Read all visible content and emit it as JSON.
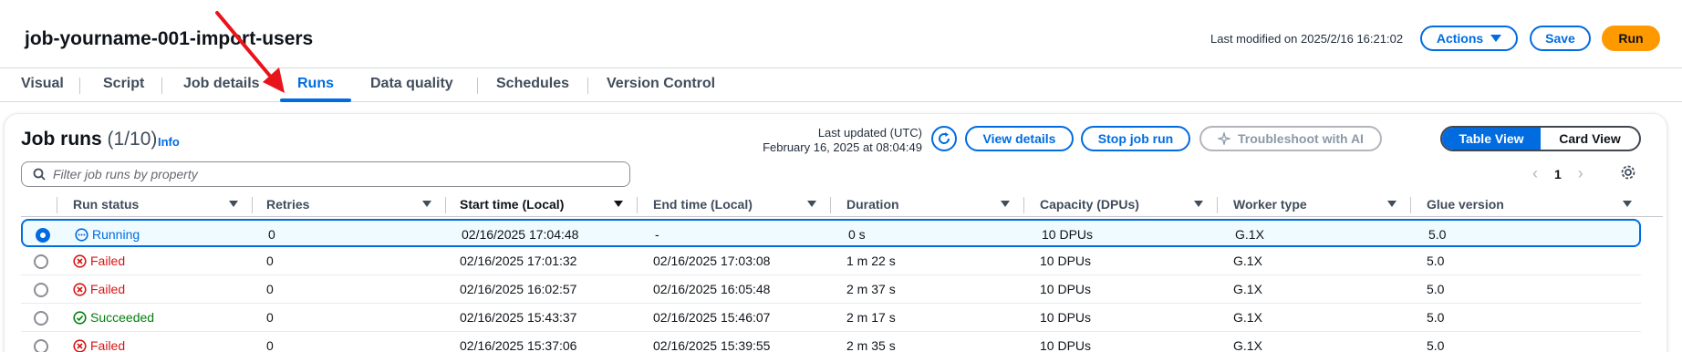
{
  "header": {
    "job_title": "job-yourname-001-import-users",
    "last_modified": "Last modified on 2025/2/16 16:21:02",
    "actions_label": "Actions",
    "save_label": "Save",
    "run_label": "Run"
  },
  "tabs": [
    {
      "label": "Visual"
    },
    {
      "label": "Script"
    },
    {
      "label": "Job details"
    },
    {
      "label": "Runs",
      "active": true
    },
    {
      "label": "Data quality"
    },
    {
      "label": "Schedules"
    },
    {
      "label": "Version Control"
    }
  ],
  "panel": {
    "title": "Job runs",
    "count": "(1/10)",
    "info": "Info",
    "last_updated_label": "Last updated (UTC)",
    "last_updated_value": "February 16, 2025 at 08:04:49",
    "view_details": "View details",
    "stop_job_run": "Stop job run",
    "troubleshoot": "Troubleshoot with AI",
    "table_view": "Table View",
    "card_view": "Card View",
    "filter_placeholder": "Filter job runs by property",
    "page": "1"
  },
  "table": {
    "columns": [
      "Run status",
      "Retries",
      "Start time (Local)",
      "End time (Local)",
      "Duration",
      "Capacity (DPUs)",
      "Worker type",
      "Glue version"
    ],
    "rows": [
      {
        "status": "Running",
        "state": "running",
        "retries": "0",
        "start": "02/16/2025 17:04:48",
        "end": "-",
        "duration": "0 s",
        "capacity": "10 DPUs",
        "worker": "G.1X",
        "glue": "5.0",
        "selected": true
      },
      {
        "status": "Failed",
        "state": "failed",
        "retries": "0",
        "start": "02/16/2025 17:01:32",
        "end": "02/16/2025 17:03:08",
        "duration": "1 m 22 s",
        "capacity": "10 DPUs",
        "worker": "G.1X",
        "glue": "5.0"
      },
      {
        "status": "Failed",
        "state": "failed",
        "retries": "0",
        "start": "02/16/2025 16:02:57",
        "end": "02/16/2025 16:05:48",
        "duration": "2 m 37 s",
        "capacity": "10 DPUs",
        "worker": "G.1X",
        "glue": "5.0"
      },
      {
        "status": "Succeeded",
        "state": "succeeded",
        "retries": "0",
        "start": "02/16/2025 15:43:37",
        "end": "02/16/2025 15:46:07",
        "duration": "2 m 17 s",
        "capacity": "10 DPUs",
        "worker": "G.1X",
        "glue": "5.0"
      },
      {
        "status": "Failed",
        "state": "failed",
        "retries": "0",
        "start": "02/16/2025 15:37:06",
        "end": "02/16/2025 15:39:55",
        "duration": "2 m 35 s",
        "capacity": "10 DPUs",
        "worker": "G.1X",
        "glue": "5.0"
      }
    ]
  },
  "icons": {
    "refresh": "refresh-icon",
    "search": "search-icon",
    "gear": "gear-icon",
    "sparkle": "sparkle-icon",
    "running": "running-status-icon",
    "failed": "failed-status-icon",
    "succeeded": "succeeded-status-icon"
  },
  "colors": {
    "primary": "#006ce0",
    "run_button": "#ff9900",
    "failed": "#d91515",
    "succeeded": "#037f0c",
    "annotation_arrow": "#e8141c"
  }
}
